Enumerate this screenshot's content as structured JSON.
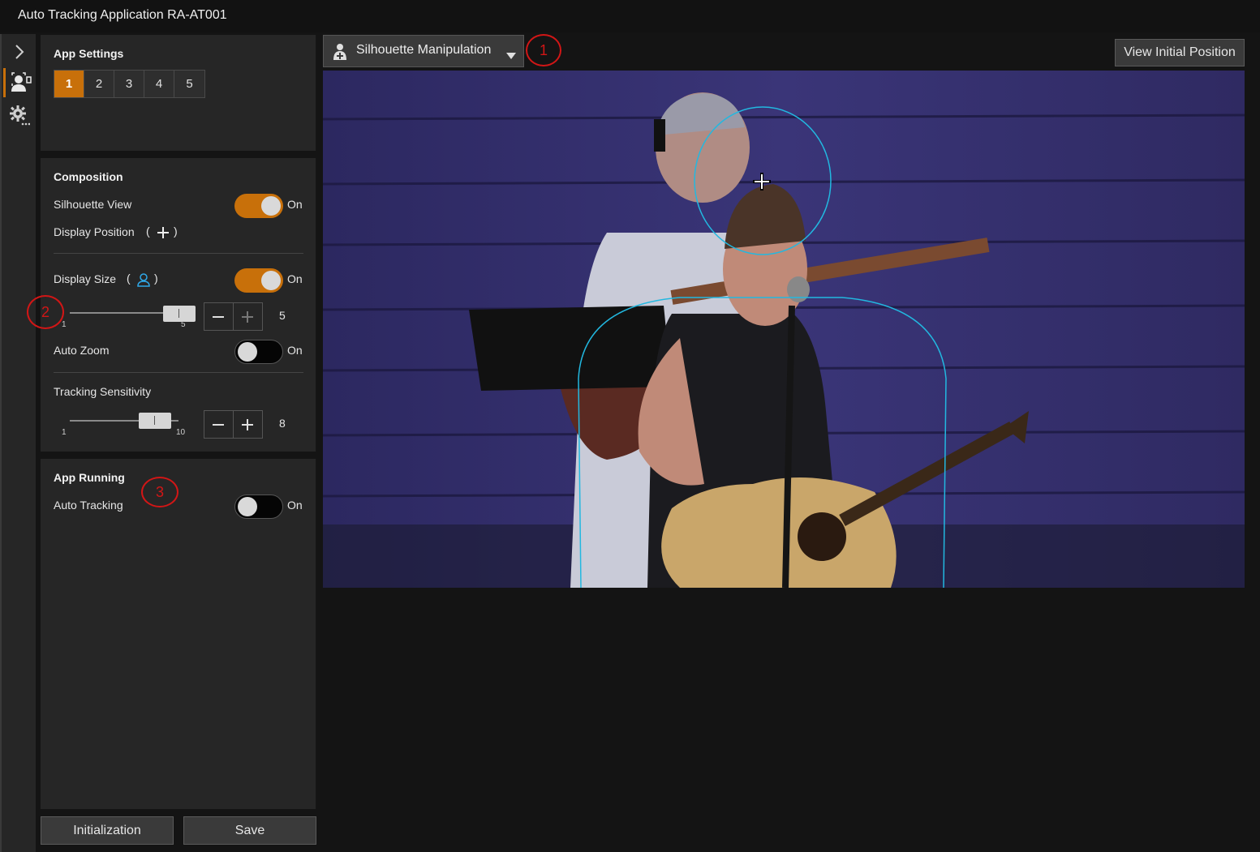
{
  "window": {
    "title": "Auto Tracking Application RA-AT001"
  },
  "sidebar_icons": [
    {
      "name": "expand-chevron-icon"
    },
    {
      "name": "person-tracking-icon"
    },
    {
      "name": "settings-gear-icon"
    }
  ],
  "app_settings": {
    "title": "App Settings",
    "tabs": [
      "1",
      "2",
      "3",
      "4",
      "5"
    ],
    "active_tab": "1"
  },
  "composition": {
    "title": "Composition",
    "silhouette_view": {
      "label": "Silhouette View",
      "state": "On"
    },
    "display_position": {
      "label": "Display Position",
      "open": "(",
      "close": ")"
    },
    "display_size": {
      "label": "Display Size",
      "open": "(",
      "close": ")",
      "state": "On",
      "slider_min": "1",
      "slider_max": "5",
      "value": "5"
    },
    "auto_zoom": {
      "label": "Auto Zoom",
      "state": "On",
      "enabled": false
    },
    "tracking_sensitivity": {
      "label": "Tracking Sensitivity",
      "slider_min": "1",
      "slider_max": "10",
      "value": "8"
    }
  },
  "app_running": {
    "title": "App Running",
    "auto_tracking": {
      "label": "Auto Tracking",
      "state": "On",
      "enabled": false
    }
  },
  "footer": {
    "initialization_label": "Initialization",
    "save_label": "Save"
  },
  "toolbar": {
    "mode_dropdown": "Silhouette Manipulation",
    "view_initial_position": "View Initial Position"
  },
  "callouts": [
    "1",
    "2",
    "3"
  ],
  "colors": {
    "accent": "#c8700a",
    "silhouette": "#22b8e0",
    "callout": "#d21616"
  }
}
